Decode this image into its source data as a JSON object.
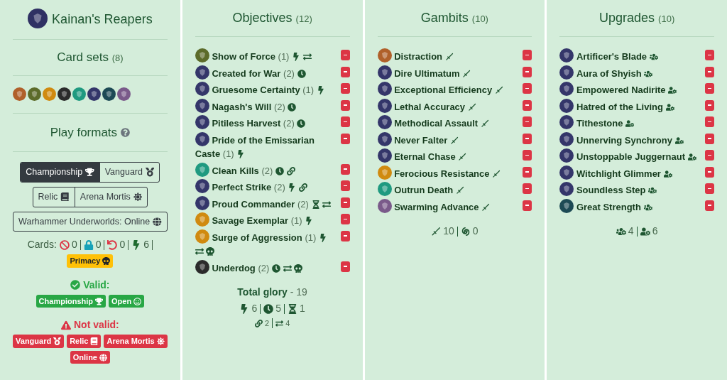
{
  "warband": {
    "name": "Kainan's Reapers",
    "color": "#2f3163"
  },
  "card_sets": {
    "title": "Card sets",
    "count": "(8)",
    "items": [
      {
        "color": "#b0602a"
      },
      {
        "color": "#5c6b2a"
      },
      {
        "color": "#d08a10"
      },
      {
        "color": "#2b2b2b"
      },
      {
        "color": "#1f9a80"
      },
      {
        "color": "#34366a"
      },
      {
        "color": "#1d4a55"
      },
      {
        "color": "#7a5a8a"
      }
    ]
  },
  "play_formats": {
    "title": "Play formats",
    "groups": [
      [
        {
          "label": "Championship",
          "kind": "trophy",
          "selected": true
        },
        {
          "label": "Vanguard",
          "kind": "medal",
          "selected": false
        }
      ],
      [
        {
          "label": "Relic",
          "kind": "book",
          "selected": false
        },
        {
          "label": "Arena Mortis",
          "kind": "sun",
          "selected": false
        }
      ],
      [
        {
          "label": "Warhammer Underworlds: Online",
          "kind": "globe",
          "selected": false
        }
      ]
    ]
  },
  "cards_stats": {
    "label": "Cards:",
    "items": [
      {
        "kind": "ban",
        "value": "0"
      },
      {
        "kind": "lock",
        "value": "0"
      },
      {
        "kind": "undo",
        "value": "0"
      },
      {
        "kind": "surge",
        "value": "6"
      }
    ],
    "primacy": {
      "label": "Primacy",
      "kind": "skull"
    }
  },
  "valid": {
    "label": "Valid:",
    "formats": [
      {
        "label": "Championship",
        "kind": "trophy"
      },
      {
        "label": "Open",
        "kind": "smile"
      }
    ]
  },
  "not_valid": {
    "label": "Not valid:",
    "formats": [
      {
        "label": "Vanguard",
        "kind": "medal"
      },
      {
        "label": "Relic",
        "kind": "book"
      },
      {
        "label": "Arena Mortis",
        "kind": "sun"
      },
      {
        "label": "Online",
        "kind": "globe"
      }
    ]
  },
  "objectives": {
    "title": "Objectives",
    "count": "(12)",
    "cards": [
      {
        "name": "Show of Force",
        "glory": "(1)",
        "color": "#5c6b2a",
        "tags": [
          {
            "kind": "surge"
          },
          {
            "kind": "swap"
          }
        ]
      },
      {
        "name": "Created for War",
        "glory": "(2)",
        "color": "#34366a",
        "tags": [
          {
            "kind": "end"
          }
        ]
      },
      {
        "name": "Gruesome Certainty",
        "glory": "(1)",
        "color": "#34366a",
        "tags": [
          {
            "kind": "surge"
          }
        ]
      },
      {
        "name": "Nagash's Will",
        "glory": "(2)",
        "color": "#34366a",
        "tags": [
          {
            "kind": "end"
          }
        ]
      },
      {
        "name": "Pitiless Harvest",
        "glory": "(2)",
        "color": "#34366a",
        "tags": [
          {
            "kind": "end"
          }
        ]
      },
      {
        "name": "Pride of the Emissarian Caste",
        "glory": "(1)",
        "color": "#34366a",
        "tags": [
          {
            "kind": "surge"
          }
        ]
      },
      {
        "name": "Clean Kills",
        "glory": "(2)",
        "color": "#1f9a80",
        "tags": [
          {
            "kind": "end"
          },
          {
            "kind": "link"
          }
        ]
      },
      {
        "name": "Perfect Strike",
        "glory": "(2)",
        "color": "#34366a",
        "tags": [
          {
            "kind": "surge"
          },
          {
            "kind": "link"
          }
        ]
      },
      {
        "name": "Proud Commander",
        "glory": "(2)",
        "color": "#34366a",
        "tags": [
          {
            "kind": "hourglass"
          },
          {
            "kind": "swap"
          }
        ]
      },
      {
        "name": "Savage Exemplar",
        "glory": "(1)",
        "color": "#d08a10",
        "tags": [
          {
            "kind": "surge"
          }
        ]
      },
      {
        "name": "Surge of Aggression",
        "glory": "(1)",
        "color": "#d08a10",
        "tags": [
          {
            "kind": "surge"
          },
          {
            "kind": "swap"
          },
          {
            "kind": "skull"
          }
        ]
      },
      {
        "name": "Underdog",
        "glory": "(2)",
        "color": "#2b2b2b",
        "tags": [
          {
            "kind": "end"
          },
          {
            "kind": "swap"
          },
          {
            "kind": "skull"
          }
        ]
      }
    ],
    "total": {
      "label": "Total glory",
      "value": "- 19"
    },
    "stats": [
      [
        {
          "kind": "surge",
          "value": "6"
        },
        {
          "kind": "end",
          "value": "5"
        },
        {
          "kind": "hourglass",
          "value": "1"
        }
      ],
      [
        {
          "kind": "link",
          "value": "2"
        },
        {
          "kind": "swap",
          "value": "4"
        }
      ]
    ]
  },
  "gambits": {
    "title": "Gambits",
    "count": "(10)",
    "cards": [
      {
        "name": "Distraction",
        "color": "#b0602a",
        "tags": [
          {
            "kind": "ploy"
          }
        ]
      },
      {
        "name": "Dire Ultimatum",
        "color": "#34366a",
        "tags": [
          {
            "kind": "ploy"
          }
        ]
      },
      {
        "name": "Exceptional Efficiency",
        "color": "#34366a",
        "tags": [
          {
            "kind": "ploy"
          }
        ]
      },
      {
        "name": "Lethal Accuracy",
        "color": "#34366a",
        "tags": [
          {
            "kind": "ploy"
          }
        ]
      },
      {
        "name": "Methodical Assault",
        "color": "#34366a",
        "tags": [
          {
            "kind": "ploy"
          }
        ]
      },
      {
        "name": "Never Falter",
        "color": "#34366a",
        "tags": [
          {
            "kind": "ploy"
          }
        ]
      },
      {
        "name": "Eternal Chase",
        "color": "#34366a",
        "tags": [
          {
            "kind": "ploy"
          }
        ]
      },
      {
        "name": "Ferocious Resistance",
        "color": "#d08a10",
        "tags": [
          {
            "kind": "ploy"
          }
        ]
      },
      {
        "name": "Outrun Death",
        "color": "#1f9a80",
        "tags": [
          {
            "kind": "ploy"
          }
        ]
      },
      {
        "name": "Swarming Advance",
        "color": "#7a5a8a",
        "tags": [
          {
            "kind": "ploy"
          }
        ]
      }
    ],
    "stats": [
      [
        {
          "kind": "ploy",
          "value": "10"
        },
        {
          "kind": "spell",
          "value": "0"
        }
      ]
    ]
  },
  "upgrades": {
    "title": "Upgrades",
    "count": "(10)",
    "cards": [
      {
        "name": "Artificer's Blade",
        "color": "#34366a",
        "tags": [
          {
            "kind": "group"
          }
        ]
      },
      {
        "name": "Aura of Shyish",
        "color": "#34366a",
        "tags": [
          {
            "kind": "group"
          }
        ]
      },
      {
        "name": "Empowered Nadirite",
        "color": "#34366a",
        "tags": [
          {
            "kind": "user"
          }
        ]
      },
      {
        "name": "Hatred of the Living",
        "color": "#34366a",
        "tags": [
          {
            "kind": "user"
          }
        ]
      },
      {
        "name": "Tithestone",
        "color": "#34366a",
        "tags": [
          {
            "kind": "user"
          }
        ]
      },
      {
        "name": "Unnerving Synchrony",
        "color": "#34366a",
        "tags": [
          {
            "kind": "user"
          }
        ]
      },
      {
        "name": "Unstoppable Juggernaut",
        "color": "#34366a",
        "tags": [
          {
            "kind": "user"
          }
        ]
      },
      {
        "name": "Witchlight Glimmer",
        "color": "#34366a",
        "tags": [
          {
            "kind": "user"
          }
        ]
      },
      {
        "name": "Soundless Step",
        "color": "#34366a",
        "tags": [
          {
            "kind": "group"
          }
        ]
      },
      {
        "name": "Great Strength",
        "color": "#1d4a55",
        "tags": [
          {
            "kind": "group"
          }
        ]
      }
    ],
    "stats": [
      [
        {
          "kind": "group",
          "value": "4"
        },
        {
          "kind": "user",
          "value": "6"
        }
      ]
    ]
  }
}
